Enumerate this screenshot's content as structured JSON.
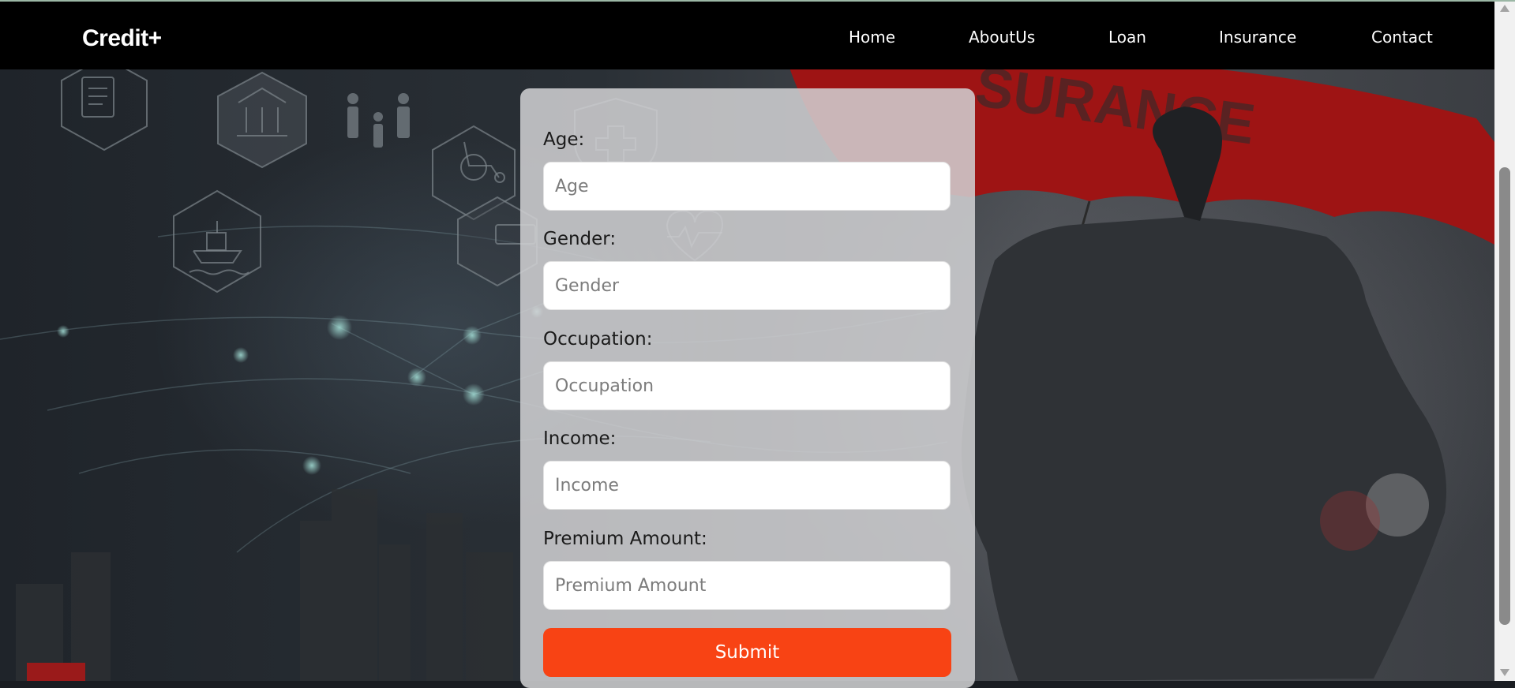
{
  "brand": {
    "name": "Credit+"
  },
  "nav": {
    "items": [
      {
        "label": "Home"
      },
      {
        "label": "AboutUs"
      },
      {
        "label": "Loan"
      },
      {
        "label": "Insurance"
      },
      {
        "label": "Contact"
      }
    ]
  },
  "background": {
    "umbrella_text": "SURANCE",
    "icons": [
      "documents-icon",
      "bank-icon",
      "family-icon",
      "wheelchair-icon",
      "health-shield-icon",
      "heartbeat-icon",
      "ship-icon",
      "bus-icon"
    ]
  },
  "form": {
    "fields": [
      {
        "label": "Age:",
        "placeholder": "Age",
        "value": ""
      },
      {
        "label": "Gender:",
        "placeholder": "Gender",
        "value": ""
      },
      {
        "label": "Occupation:",
        "placeholder": "Occupation",
        "value": ""
      },
      {
        "label": "Income:",
        "placeholder": "Income",
        "value": ""
      },
      {
        "label": "Premium Amount:",
        "placeholder": "Premium Amount",
        "value": ""
      }
    ],
    "submit_label": "Submit"
  },
  "colors": {
    "navbar": "#000000",
    "accent": "#f84314",
    "umbrella": "#9e1414",
    "card": "#d2d2d4"
  }
}
